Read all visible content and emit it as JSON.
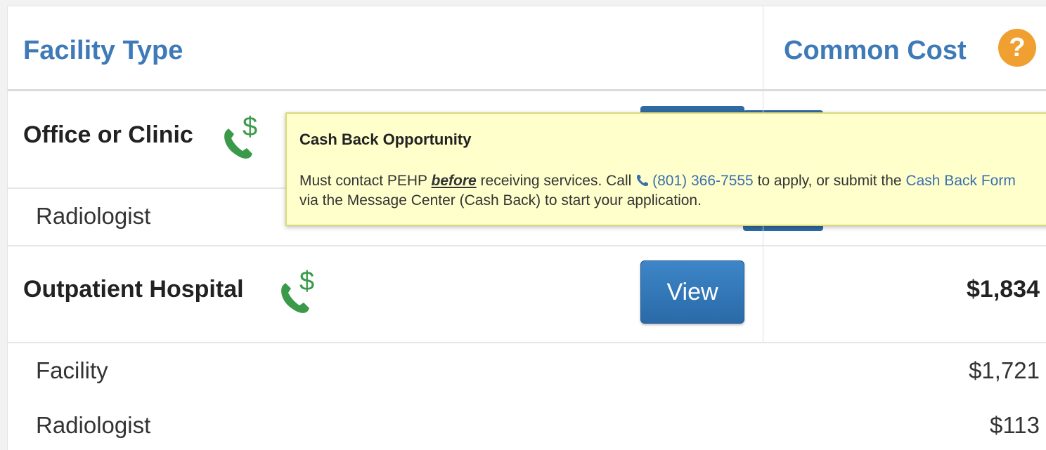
{
  "table": {
    "headers": {
      "facility_type": "Facility Type",
      "common_cost": "Common Cost",
      "help_glyph": "?"
    },
    "rows": [
      {
        "title": "Office or Clinic",
        "button": "View",
        "sub": [
          {
            "label": "Radiologist",
            "amount": ""
          }
        ]
      },
      {
        "title": "Outpatient Hospital",
        "button": "View",
        "amount": "$1,834",
        "sub": [
          {
            "label": "Facility",
            "amount": "$1,721"
          },
          {
            "label": "Radiologist",
            "amount": "$113"
          }
        ]
      }
    ],
    "cash_icon_glyph": "$"
  },
  "tooltip": {
    "title": "Cash Back Opportunity",
    "before_prefix": "Must contact PEHP ",
    "emphasis": "before",
    "after_emphasis": " receiving services. Call ",
    "phone": "(801) 366-7555",
    "mid_text": " to apply, or submit the ",
    "form_link": "Cash Back Form",
    "end_text": " via the Message Center (Cash Back) to start your application."
  },
  "colors": {
    "header_blue": "#3f7ab8",
    "button_blue": "#2f73b6",
    "tooltip_bg": "#ffffcc",
    "cash_green": "#3a9a4a",
    "help_orange": "#f0a030"
  },
  "icons": [
    "cash-back-phone-icon",
    "help-icon",
    "phone-icon"
  ]
}
